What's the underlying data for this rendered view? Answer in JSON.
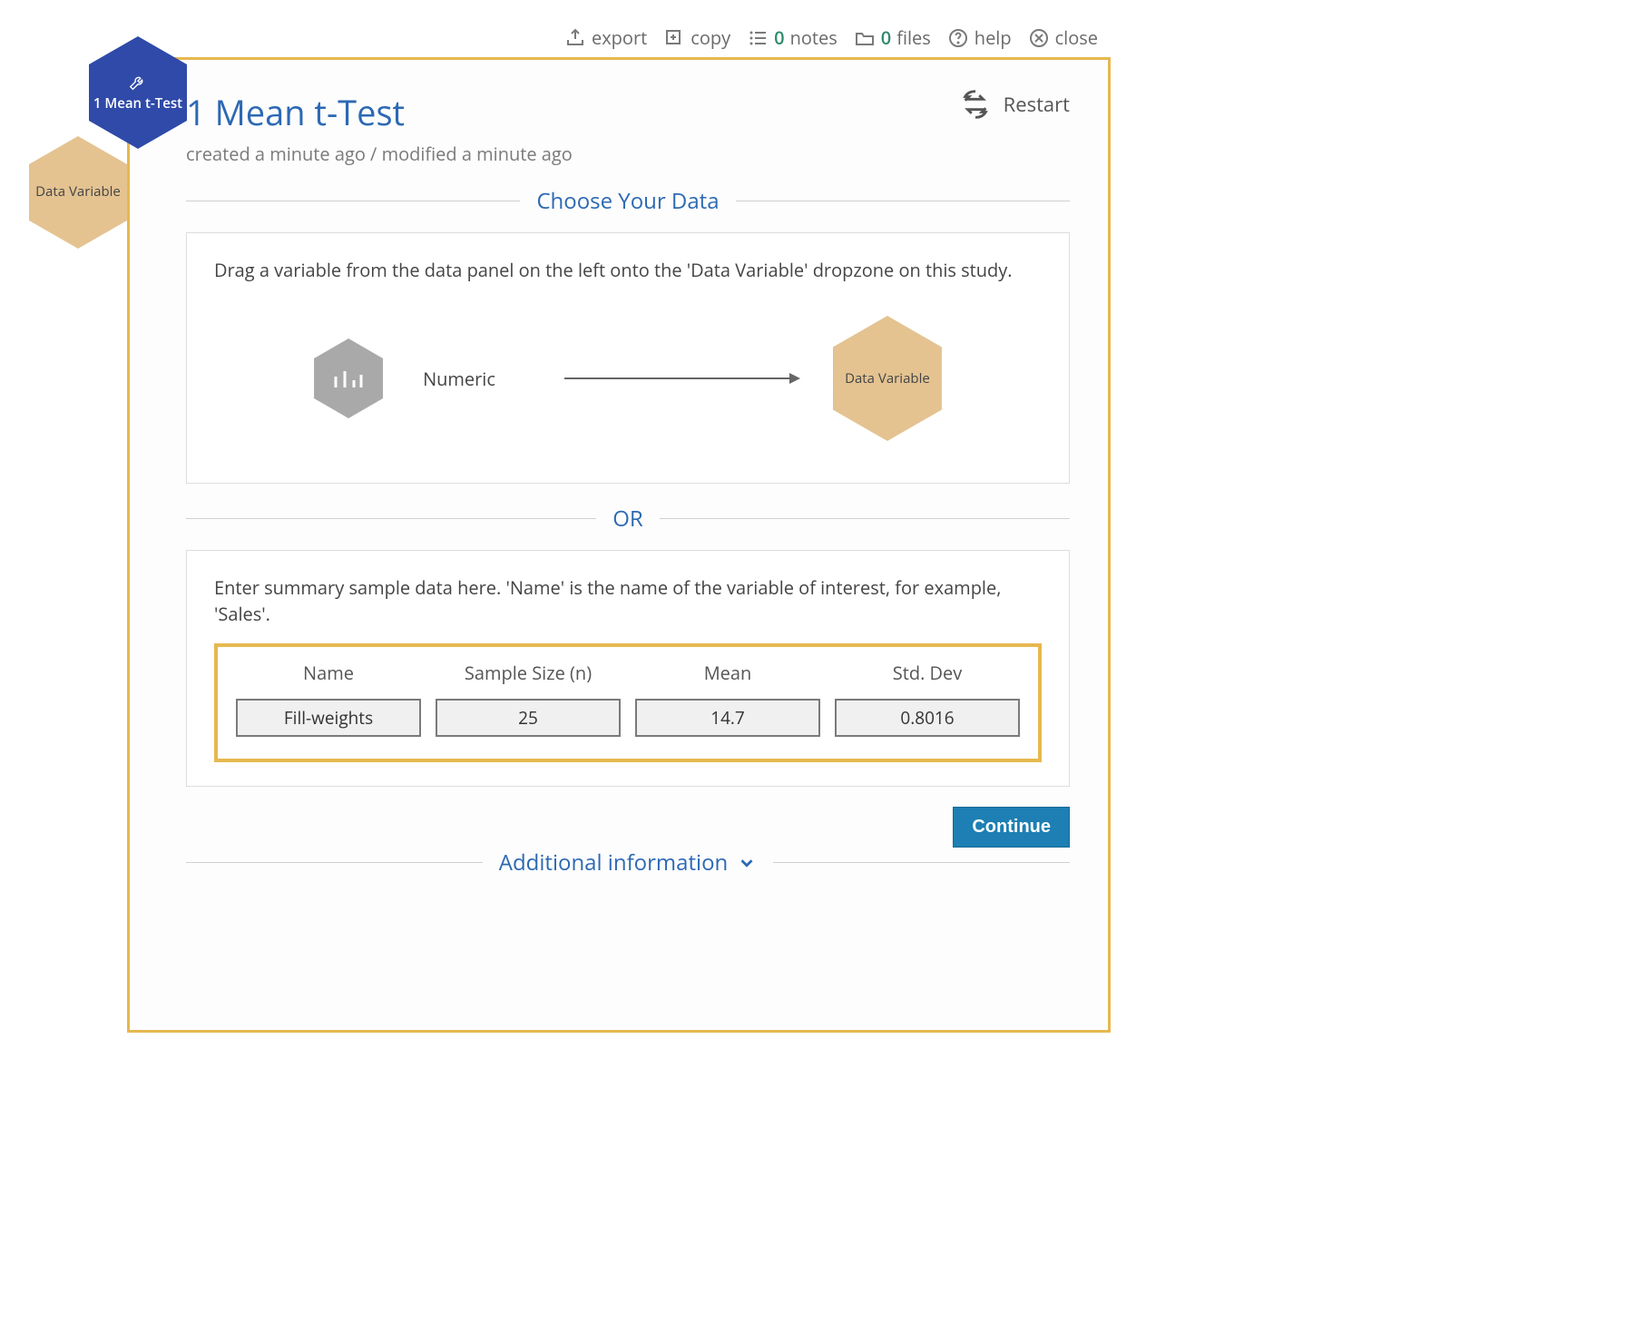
{
  "topbar": {
    "export": "export",
    "copy": "copy",
    "notes_count": "0",
    "notes_label": "notes",
    "files_count": "0",
    "files_label": "files",
    "help": "help",
    "close": "close"
  },
  "sidehex": {
    "primary": "1 Mean t-Test",
    "secondary": "Data Variable"
  },
  "header": {
    "title": "1 Mean t-Test",
    "subtitle": "created a minute ago / modified a minute ago",
    "restart": "Restart"
  },
  "sections": {
    "choose_data": "Choose Your Data",
    "or": "OR",
    "additional": "Additional information"
  },
  "drag_card": {
    "instruction": "Drag a variable from the data panel on the left onto the 'Data Variable' dropzone on this study.",
    "numeric_label": "Numeric",
    "target_label": "Data Variable"
  },
  "summary_card": {
    "instruction": "Enter summary sample data here. 'Name' is the name of the variable of interest, for example, 'Sales'.",
    "columns": {
      "name": "Name",
      "sample_size": "Sample Size (n)",
      "mean": "Mean",
      "std_dev": "Std. Dev"
    },
    "values": {
      "name": "Fill-weights",
      "sample_size": "25",
      "mean": "14.7",
      "std_dev": "0.8016"
    }
  },
  "buttons": {
    "continue": "Continue"
  }
}
